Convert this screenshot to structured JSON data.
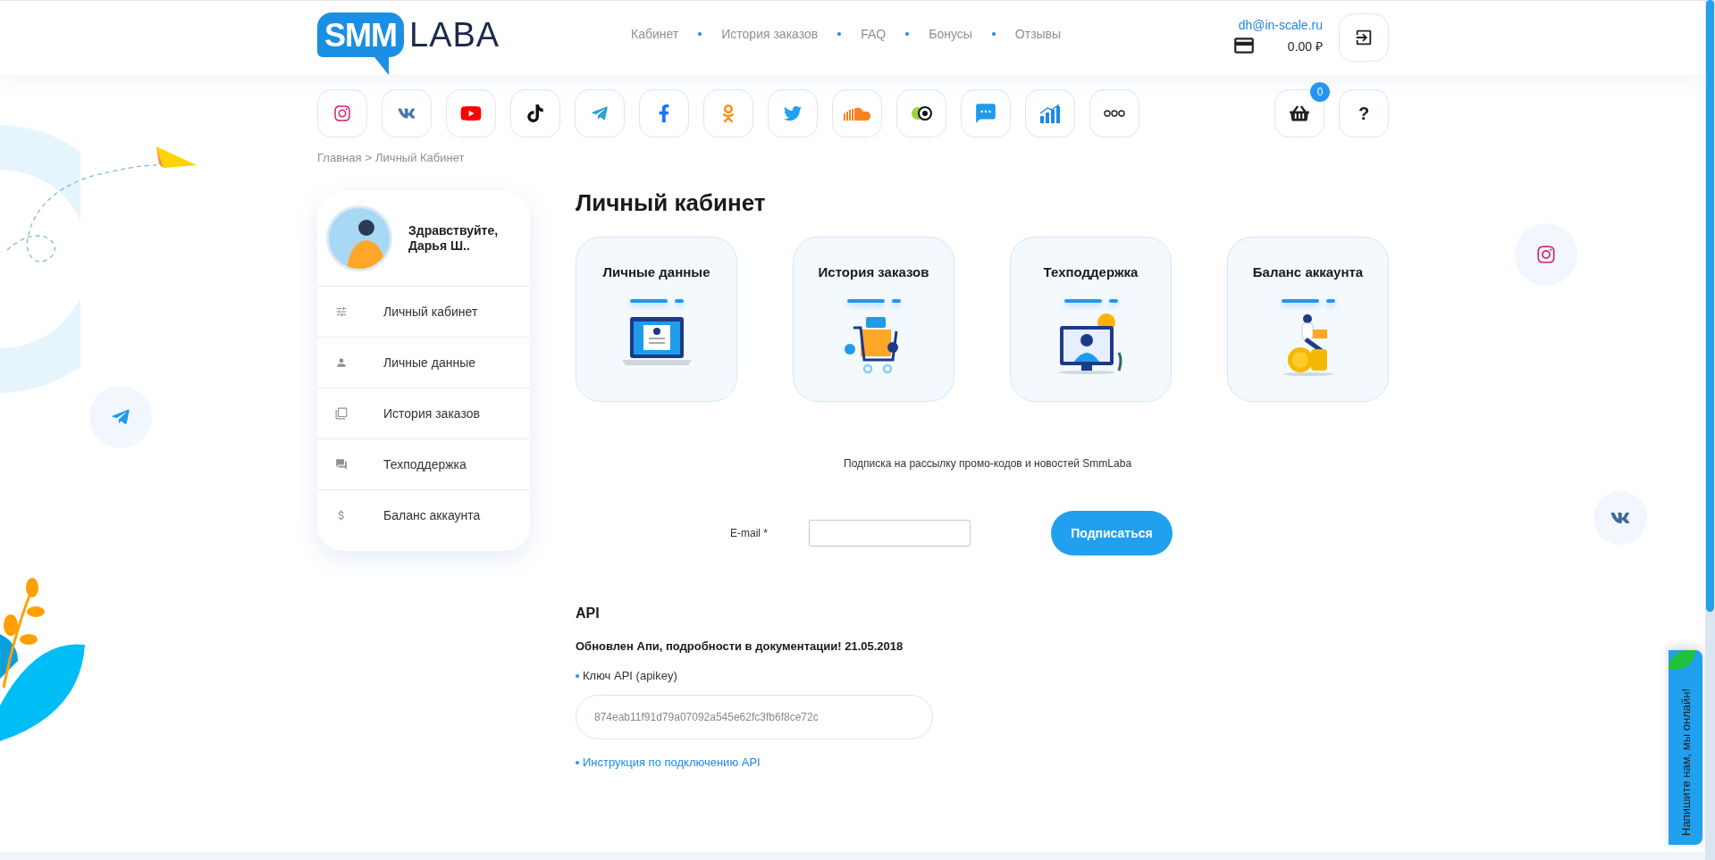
{
  "header": {
    "logo": {
      "mark": "SMM",
      "word": "LABA"
    },
    "nav": [
      "Кабинет",
      "История заказов",
      "FAQ",
      "Бонусы",
      "Отзывы"
    ],
    "account": {
      "email": "dh@in-scale.ru",
      "balance": "0.00 ₽"
    }
  },
  "services": [
    {
      "kind": "instagram"
    },
    {
      "kind": "vk"
    },
    {
      "kind": "youtube"
    },
    {
      "kind": "tiktok"
    },
    {
      "kind": "telegram"
    },
    {
      "kind": "facebook"
    },
    {
      "kind": "odnoklassniki"
    },
    {
      "kind": "twitter"
    },
    {
      "kind": "soundcloud"
    },
    {
      "kind": "likee"
    },
    {
      "kind": "sms"
    },
    {
      "kind": "stats"
    },
    {
      "kind": "more"
    }
  ],
  "cart": {
    "count": "0"
  },
  "help": "?",
  "breadcrumb": {
    "items": [
      "Главная",
      "Личный Кабинет"
    ],
    "separator": ">"
  },
  "sidebar": {
    "greeting": "Здравствуйте,",
    "name": "Дарья Ш..",
    "items": [
      {
        "kind": "settings",
        "label": "Личный кабинет"
      },
      {
        "kind": "profile",
        "label": "Личные данные"
      },
      {
        "kind": "history",
        "label": "История заказов"
      },
      {
        "kind": "support",
        "label": "Техподдержка"
      },
      {
        "kind": "balance",
        "label": "Баланс аккаунта"
      }
    ]
  },
  "page_title": "Личный кабинет",
  "cards": [
    {
      "kind": "profile",
      "title": "Личные данные"
    },
    {
      "kind": "history",
      "title": "История заказов"
    },
    {
      "kind": "support",
      "title": "Техподдержка"
    },
    {
      "kind": "balance",
      "title": "Баланс аккаунта"
    }
  ],
  "subscribe": {
    "text": "Подписка на рассылку промо-кодов и новостей SmmLaba",
    "label": "E-mail",
    "required_mark": "*",
    "button": "Подписаться"
  },
  "api": {
    "heading": "API",
    "notice": "Обновлен Апи, подробности в документации! 21.05.2018",
    "key_label": "Ключ API (apikey)",
    "key": "874eab11f91d79a07092a545e62fc3fb6f8ce72c",
    "doc_link": "Инструкция по подключению API"
  },
  "floating": [
    {
      "kind": "instagram"
    },
    {
      "kind": "telegram"
    },
    {
      "kind": "vk"
    }
  ],
  "chat_tab": "Напишите нам, мы онлайн!"
}
